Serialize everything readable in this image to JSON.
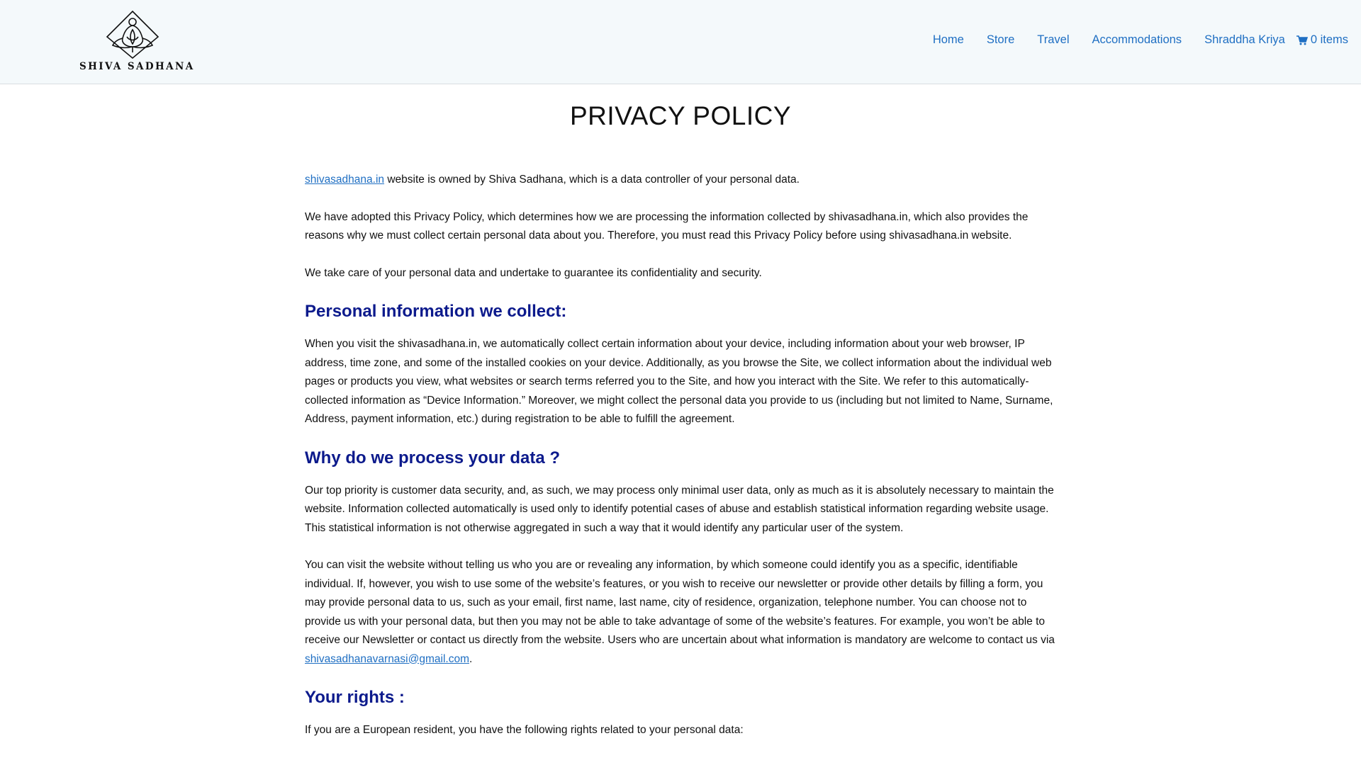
{
  "header": {
    "logo_text": "SHIVA SADHANA",
    "nav": [
      {
        "label": "Home"
      },
      {
        "label": "Store"
      },
      {
        "label": "Travel"
      },
      {
        "label": "Accommodations"
      },
      {
        "label": "Shraddha Kriya"
      }
    ],
    "cart_label": "0 items",
    "cart_icon": "shopping-cart-icon",
    "link_color": "#1f6fc3"
  },
  "page": {
    "title": "PRIVACY POLICY",
    "heading_color": "#0c1a8c",
    "intro": {
      "link": "shivasadhana.in",
      "text": " website is owned by Shiva Sadhana, which is a data controller of your personal data."
    },
    "p_adopted": "We have adopted this Privacy Policy, which determines how we are processing the information collected by shivasadhana.in, which also provides the reasons why we must collect certain personal data about you. Therefore, you must read this Privacy Policy before using shivasadhana.in website.",
    "p_care": "We take care of your personal data and undertake to guarantee its confidentiality and security.",
    "h_collect": "Personal information we collect:",
    "p_collect": "When you visit the shivasadhana.in, we automatically collect certain information about your device, including information about your web browser, IP address, time zone, and some of the installed cookies on your device. Additionally, as you browse the Site, we collect information about the individual web pages or products you view, what websites or search terms referred you to the Site, and how you interact with the Site. We refer to this automatically-collected information as “Device Information.” Moreover, we might collect the personal data you provide to us (including but not limited to Name, Surname, Address, payment information, etc.) during registration to be able to fulfill the agreement.",
    "h_why": "Why do we process your data ?",
    "p_why": "Our top priority is customer data security, and, as such, we may process only minimal user data, only as much as it is absolutely necessary to maintain the website. Information collected automatically is used only to identify potential cases of abuse and establish statistical information regarding website usage. This statistical information is not otherwise aggregated in such a way that it would identify any particular user of the system.",
    "p_visit": {
      "text": "You can visit the website without telling us who you are or revealing any information, by which someone could identify you as a specific, identifiable individual. If, however, you wish to use some of the website’s features, or you wish to receive our newsletter or provide other details by filling a form, you may provide personal data to us, such as your email, first name, last name, city of residence, organization, telephone number. You can choose not to provide us with your personal data, but then you may not be able to take advantage of some of the website’s features. For example, you won’t be able to receive our Newsletter or contact us directly from the website. Users who are uncertain about what information is mandatory are welcome to contact us via ",
      "email": "shivasadhanavarnasi@gmail.com",
      "end": "."
    },
    "h_rights": "Your rights :",
    "p_rights": "If you are a European resident, you have the following rights related to your personal data:"
  }
}
